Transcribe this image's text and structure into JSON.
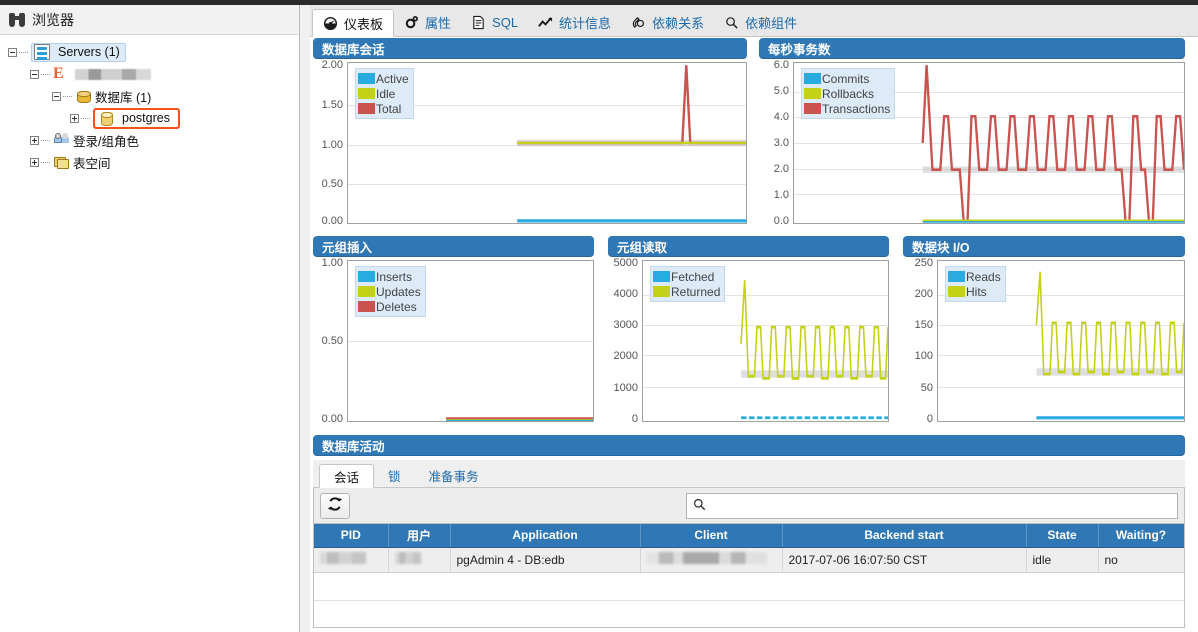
{
  "browser": {
    "title": "浏览器",
    "icon": "binoculars-icon",
    "tree": [
      {
        "label": "Servers (1)",
        "icon": "servers-icon",
        "level": 0,
        "toggle": "minus",
        "selected": true
      },
      {
        "label": "",
        "icon": "edb-server-icon",
        "level": 1,
        "toggle": "minus",
        "redacted": true
      },
      {
        "label": "数据库 (1)",
        "icon": "databases-icon",
        "level": 2,
        "toggle": "minus"
      },
      {
        "label": "postgres",
        "icon": "database-icon",
        "level": 3,
        "toggle": "plus",
        "highlighted": true
      },
      {
        "label": "登录/组角色",
        "icon": "roles-icon",
        "level": 2,
        "toggle": "plus"
      },
      {
        "label": "表空间",
        "icon": "tablespaces-icon",
        "level": 2,
        "toggle": "plus"
      }
    ]
  },
  "tabs": [
    {
      "label": "仪表板",
      "icon": "dashboard-icon",
      "active": true
    },
    {
      "label": "属性",
      "icon": "gear-icon",
      "active": false
    },
    {
      "label": "SQL",
      "icon": "document-icon",
      "active": false
    },
    {
      "label": "统计信息",
      "icon": "chart-line-icon",
      "active": false
    },
    {
      "label": "依赖关系",
      "icon": "dependencies-icon",
      "active": false
    },
    {
      "label": "依赖组件",
      "icon": "dependents-icon",
      "active": false
    }
  ],
  "colors": {
    "header_blue": "#2f77b5",
    "series_blue": "#29abe2",
    "series_green": "#c3d117",
    "series_red": "#c9534f",
    "highlight_orange": "#f4511e"
  },
  "chart_data": [
    {
      "id": "db-sessions",
      "type": "line",
      "title": "数据库会话",
      "ylabel": "",
      "xlabel": "",
      "ylim": [
        0,
        2
      ],
      "yticks": [
        "0.00",
        "0.50",
        "1.00",
        "1.50",
        "2.00"
      ],
      "grid": true,
      "legend_position": "top-left",
      "series": [
        {
          "name": "Active",
          "color": "#29abe2",
          "values": [
            0,
            0,
            0,
            0,
            0,
            0,
            0,
            0,
            0,
            0,
            0,
            0,
            0,
            0,
            0,
            0,
            0,
            0,
            0,
            0,
            0,
            0,
            0,
            0,
            0,
            0,
            0,
            0,
            0,
            0,
            0,
            0,
            0,
            0,
            0,
            0,
            0,
            0,
            0,
            0
          ]
        },
        {
          "name": "Idle",
          "color": "#c3d117",
          "values": [
            null,
            null,
            null,
            null,
            null,
            null,
            null,
            null,
            null,
            null,
            null,
            null,
            null,
            1,
            1,
            1,
            1,
            1,
            1,
            1,
            1,
            1,
            1,
            1,
            1,
            1,
            1,
            1,
            1,
            1,
            1,
            1,
            1,
            1,
            1,
            1,
            1,
            1,
            1,
            1
          ]
        },
        {
          "name": "Total",
          "color": "#c9534f",
          "values": [
            null,
            null,
            null,
            null,
            null,
            null,
            null,
            null,
            null,
            null,
            null,
            null,
            null,
            1,
            1,
            1,
            1,
            1,
            1,
            1,
            1,
            1,
            1,
            1,
            1,
            1,
            1,
            1,
            1,
            1,
            1,
            1,
            1,
            2,
            1,
            1,
            1,
            1,
            1,
            1
          ]
        }
      ]
    },
    {
      "id": "tps",
      "type": "line",
      "title": "每秒事务数",
      "ylim": [
        0,
        6
      ],
      "yticks": [
        "0.0",
        "1.0",
        "2.0",
        "3.0",
        "4.0",
        "5.0",
        "6.0"
      ],
      "grid": true,
      "legend_position": "top-left",
      "series": [
        {
          "name": "Commits",
          "color": "#29abe2",
          "values": [
            null,
            null,
            null,
            null,
            null,
            null,
            null,
            null,
            null,
            null,
            null,
            null,
            null,
            null,
            0,
            0,
            0,
            0,
            0,
            0,
            0,
            0,
            0,
            0,
            0,
            0,
            0,
            0,
            0,
            0,
            0,
            0,
            0,
            0,
            0,
            0,
            0,
            0,
            0,
            0,
            0,
            0,
            0,
            0,
            0,
            0,
            0,
            0,
            0,
            0
          ]
        },
        {
          "name": "Rollbacks",
          "color": "#c3d117",
          "values": [
            null,
            null,
            null,
            null,
            null,
            null,
            null,
            null,
            null,
            null,
            null,
            null,
            null,
            null,
            0,
            0,
            0,
            0,
            0,
            0,
            0,
            0,
            0,
            0,
            0,
            0,
            0,
            0,
            0,
            0,
            0,
            0,
            0,
            0,
            0,
            0,
            0,
            0,
            0,
            0,
            0,
            0,
            0,
            0,
            0,
            0,
            0,
            0,
            0,
            0
          ]
        },
        {
          "name": "Transactions",
          "color": "#c9534f",
          "values": [
            null,
            null,
            null,
            null,
            null,
            null,
            null,
            null,
            null,
            null,
            null,
            null,
            null,
            null,
            4,
            6,
            2,
            2,
            4,
            2,
            2,
            4,
            0,
            2,
            4,
            2,
            2,
            4,
            2,
            2,
            4,
            2,
            2,
            4,
            2,
            2,
            4,
            2,
            2,
            4,
            2,
            2,
            4,
            2,
            4,
            0,
            2,
            4,
            0,
            2,
            4,
            2
          ]
        }
      ]
    },
    {
      "id": "tuples-in",
      "type": "line",
      "title": "元组插入",
      "ylim": [
        0,
        1
      ],
      "yticks": [
        "0.00",
        "0.50",
        "1.00"
      ],
      "grid": true,
      "legend_position": "top-left",
      "series": [
        {
          "name": "Inserts",
          "color": "#29abe2",
          "values": [
            null,
            null,
            null,
            null,
            null,
            null,
            null,
            null,
            null,
            null,
            null,
            null,
            null,
            null,
            0,
            0,
            0,
            0,
            0,
            0,
            0,
            0,
            0,
            0,
            0,
            0,
            0,
            0,
            0,
            0,
            0,
            0,
            0,
            0,
            0,
            0,
            0,
            0,
            0,
            0
          ]
        },
        {
          "name": "Updates",
          "color": "#c3d117",
          "values": [
            null,
            null,
            null,
            null,
            null,
            null,
            null,
            null,
            null,
            null,
            null,
            null,
            null,
            null,
            0,
            0,
            0,
            0,
            0,
            0,
            0,
            0,
            0,
            0,
            0,
            0,
            0,
            0,
            0,
            0,
            0,
            0,
            0,
            0,
            0,
            0,
            0,
            0,
            0,
            0
          ]
        },
        {
          "name": "Deletes",
          "color": "#c9534f",
          "values": [
            null,
            null,
            null,
            null,
            null,
            null,
            null,
            null,
            null,
            null,
            null,
            null,
            null,
            null,
            0,
            0,
            0,
            0,
            0,
            0,
            0,
            0,
            0,
            0,
            0,
            0,
            0,
            0,
            0,
            0,
            0,
            0,
            0,
            0,
            0,
            0,
            0,
            0,
            0,
            0
          ]
        }
      ]
    },
    {
      "id": "tuples-out",
      "type": "line",
      "title": "元组读取",
      "ylim": [
        0,
        5000
      ],
      "yticks": [
        "0",
        "1000",
        "2000",
        "3000",
        "4000",
        "5000"
      ],
      "grid": true,
      "legend_position": "top-left",
      "series": [
        {
          "name": "Fetched",
          "color": "#29abe2",
          "values": [
            null,
            null,
            null,
            null,
            null,
            null,
            null,
            null,
            null,
            null,
            null,
            null,
            null,
            null,
            60,
            60,
            60,
            60,
            60,
            60,
            60,
            60,
            60,
            60,
            60,
            60,
            60,
            60,
            60,
            60,
            60,
            60,
            60,
            60,
            60,
            60,
            60,
            60,
            60,
            60,
            60,
            60
          ]
        },
        {
          "name": "Returned",
          "color": "#c3d117",
          "values": [
            null,
            null,
            null,
            null,
            null,
            null,
            null,
            null,
            null,
            null,
            null,
            null,
            null,
            null,
            2600,
            4350,
            1400,
            1500,
            2900,
            1450,
            1450,
            2950,
            1400,
            1450,
            2900,
            1450,
            1500,
            2900,
            1450,
            1450,
            2900,
            1450,
            1450,
            2900,
            1450,
            1500,
            2900,
            1450,
            1450,
            2900,
            1450,
            1450,
            2900,
            1450,
            1500,
            2900,
            1450,
            1450,
            2900,
            1450,
            2900
          ]
        }
      ]
    },
    {
      "id": "block-io",
      "type": "line",
      "title": "数据块 I/O",
      "ylim": [
        0,
        250
      ],
      "yticks": [
        "0",
        "50",
        "100",
        "150",
        "200",
        "250"
      ],
      "grid": true,
      "legend_position": "top-left",
      "series": [
        {
          "name": "Reads",
          "color": "#29abe2",
          "values": [
            null,
            null,
            null,
            null,
            null,
            null,
            null,
            null,
            null,
            null,
            null,
            null,
            null,
            null,
            2,
            2,
            2,
            2,
            2,
            2,
            2,
            2,
            2,
            2,
            2,
            2,
            2,
            2,
            2,
            2,
            2,
            2,
            2,
            2,
            2,
            2,
            2,
            2,
            2,
            2,
            2,
            2
          ]
        },
        {
          "name": "Hits",
          "color": "#c3d117",
          "values": [
            null,
            null,
            null,
            null,
            null,
            null,
            null,
            null,
            null,
            null,
            null,
            null,
            null,
            null,
            150,
            233,
            75,
            80,
            155,
            78,
            78,
            155,
            75,
            78,
            155,
            78,
            80,
            155,
            78,
            78,
            155,
            78,
            78,
            155,
            78,
            80,
            155,
            78,
            78,
            155,
            78,
            78,
            155,
            78,
            80,
            155,
            78,
            78,
            155,
            78,
            155
          ]
        }
      ]
    }
  ],
  "activity": {
    "title": "数据库活动",
    "tabs": [
      {
        "label": "会话",
        "active": true
      },
      {
        "label": "锁",
        "active": false
      },
      {
        "label": "准备事务",
        "active": false
      }
    ],
    "refresh_icon": "refresh-icon",
    "search": {
      "icon": "search-icon",
      "value": "",
      "placeholder": ""
    },
    "table": {
      "columns": [
        "PID",
        "用户",
        "Application",
        "Client",
        "Backend start",
        "State",
        "Waiting?"
      ],
      "rows": [
        {
          "PID": "",
          "用户": "",
          "Application": "pgAdmin 4 - DB:edb",
          "Client": "",
          "Backend start": "2017-07-06 16:07:50 CST",
          "State": "idle",
          "Waiting?": "no",
          "redacted": [
            "PID",
            "用户",
            "Client"
          ]
        }
      ]
    }
  }
}
